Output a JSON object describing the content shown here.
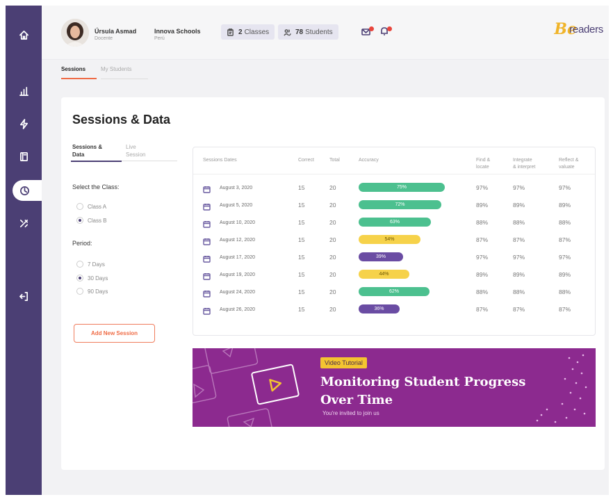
{
  "header": {
    "user": {
      "name": "Úrsula Asmad",
      "role": "Docente"
    },
    "school": {
      "name": "Innova Schools",
      "country": "Perú"
    },
    "classes": {
      "count": "2",
      "label": "Classes"
    },
    "students": {
      "count": "78",
      "label": "Students"
    },
    "logo_mark": "Be",
    "logo_text": "readers"
  },
  "top_tabs": [
    "Sessions",
    "My Students"
  ],
  "card": {
    "title": "Sessions & Data",
    "sub_tabs": [
      {
        "line1": "Sessions &",
        "line2": "Data"
      },
      {
        "line1": "Live",
        "line2": "Session"
      }
    ],
    "select_class_label": "Select the Class:",
    "classes": [
      {
        "label": "Class A",
        "selected": false
      },
      {
        "label": "Class B",
        "selected": true
      }
    ],
    "period_label": "Period:",
    "periods": [
      {
        "label": "7 Days",
        "selected": false
      },
      {
        "label": "30 Days",
        "selected": true
      },
      {
        "label": "90 Days",
        "selected": false
      }
    ],
    "add_button": "Add New Session"
  },
  "table": {
    "headers": {
      "dates": "Sessions Dates",
      "correct": "Correct",
      "total": "Total",
      "accuracy": "Accuracy",
      "find1": "Find &",
      "find2": "locate",
      "integrate1": "Integrate",
      "integrate2": "& interpret",
      "reflect1": "Reflect &",
      "reflect2": "valuate"
    },
    "rows": [
      {
        "date": "August 3, 2020",
        "correct": "15",
        "total": "20",
        "accuracy": "75%",
        "accuracy_value": 75,
        "color": "#4cc08f",
        "find": "97%",
        "integrate": "97%",
        "reflect": "97%"
      },
      {
        "date": "August 5, 2020",
        "correct": "15",
        "total": "20",
        "accuracy": "72%",
        "accuracy_value": 72,
        "color": "#4cc08f",
        "find": "89%",
        "integrate": "89%",
        "reflect": "89%"
      },
      {
        "date": "August 10, 2020",
        "correct": "15",
        "total": "20",
        "accuracy": "63%",
        "accuracy_value": 63,
        "color": "#4cc08f",
        "find": "88%",
        "integrate": "88%",
        "reflect": "88%"
      },
      {
        "date": "August 12, 2020",
        "correct": "15",
        "total": "20",
        "accuracy": "54%",
        "accuracy_value": 54,
        "color": "#f6d24a",
        "find": "87%",
        "integrate": "87%",
        "reflect": "87%"
      },
      {
        "date": "August 17, 2020",
        "correct": "15",
        "total": "20",
        "accuracy": "39%",
        "accuracy_value": 39,
        "color": "#6a4ca3",
        "find": "97%",
        "integrate": "97%",
        "reflect": "97%"
      },
      {
        "date": "August 19, 2020",
        "correct": "15",
        "total": "20",
        "accuracy": "44%",
        "accuracy_value": 44,
        "color": "#f6d24a",
        "find": "89%",
        "integrate": "89%",
        "reflect": "89%"
      },
      {
        "date": "August 24, 2020",
        "correct": "15",
        "total": "20",
        "accuracy": "62%",
        "accuracy_value": 62,
        "color": "#4cc08f",
        "find": "88%",
        "integrate": "88%",
        "reflect": "88%"
      },
      {
        "date": "August 26, 2020",
        "correct": "15",
        "total": "20",
        "accuracy": "36%",
        "accuracy_value": 36,
        "color": "#6a4ca3",
        "find": "87%",
        "integrate": "87%",
        "reflect": "87%"
      }
    ]
  },
  "banner": {
    "badge": "Video Tutorial",
    "title_line1": "Monitoring Student Progress",
    "title_line2": "Over Time",
    "subtitle": "You're invited to join us"
  },
  "colors": {
    "sidebar": "#4b3f74",
    "accent": "#ef6b45",
    "banner": "#8c2a8f",
    "good": "#4cc08f",
    "mid": "#f6d24a",
    "low": "#6a4ca3"
  }
}
